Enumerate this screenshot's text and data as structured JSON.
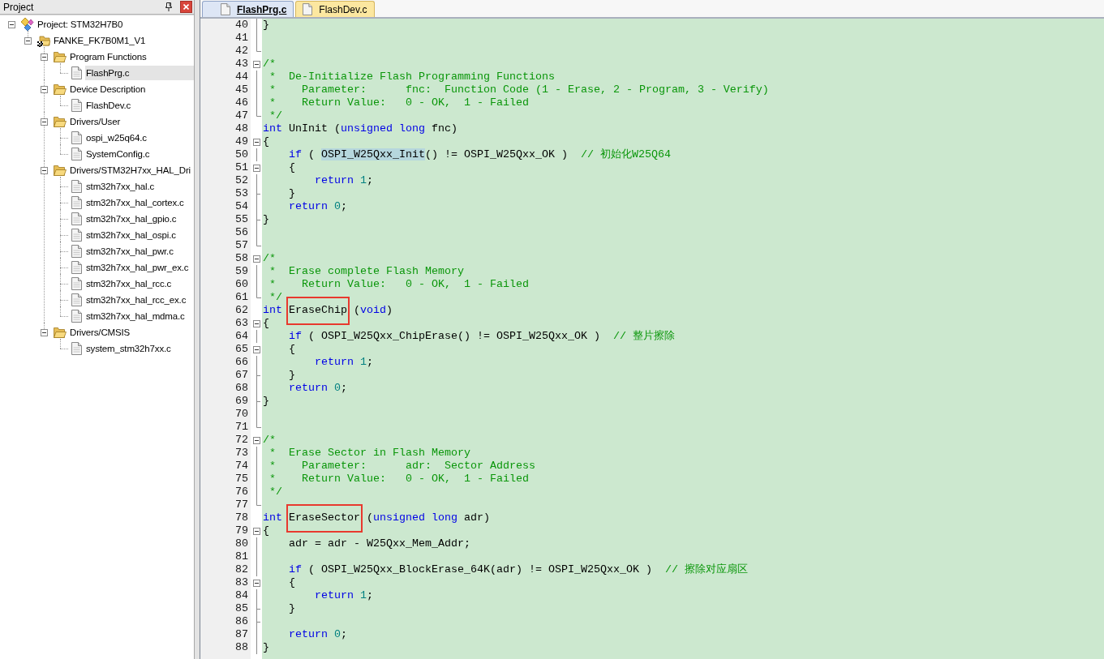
{
  "project_panel": {
    "title": "Project",
    "tree": [
      {
        "label": "Project: STM32H7B0",
        "kind": "project",
        "expanded": true,
        "selected": false,
        "children": [
          {
            "label": "FANKE_FK7B0M1_V1",
            "kind": "target",
            "expanded": true,
            "selected": false,
            "children": [
              {
                "label": "Program Functions",
                "kind": "group",
                "expanded": true,
                "selected": false,
                "children": [
                  {
                    "label": "FlashPrg.c",
                    "kind": "file",
                    "selected": true
                  }
                ]
              },
              {
                "label": "Device Description",
                "kind": "group",
                "expanded": true,
                "selected": false,
                "children": [
                  {
                    "label": "FlashDev.c",
                    "kind": "file",
                    "selected": false
                  }
                ]
              },
              {
                "label": "Drivers/User",
                "kind": "group",
                "expanded": true,
                "selected": false,
                "children": [
                  {
                    "label": "ospi_w25q64.c",
                    "kind": "file",
                    "selected": false
                  },
                  {
                    "label": "SystemConfig.c",
                    "kind": "file",
                    "selected": false
                  }
                ]
              },
              {
                "label": "Drivers/STM32H7xx_HAL_Dri",
                "kind": "group",
                "expanded": true,
                "selected": false,
                "children": [
                  {
                    "label": "stm32h7xx_hal.c",
                    "kind": "file",
                    "selected": false
                  },
                  {
                    "label": "stm32h7xx_hal_cortex.c",
                    "kind": "file",
                    "selected": false
                  },
                  {
                    "label": "stm32h7xx_hal_gpio.c",
                    "kind": "file",
                    "selected": false
                  },
                  {
                    "label": "stm32h7xx_hal_ospi.c",
                    "kind": "file",
                    "selected": false
                  },
                  {
                    "label": "stm32h7xx_hal_pwr.c",
                    "kind": "file",
                    "selected": false
                  },
                  {
                    "label": "stm32h7xx_hal_pwr_ex.c",
                    "kind": "file",
                    "selected": false
                  },
                  {
                    "label": "stm32h7xx_hal_rcc.c",
                    "kind": "file",
                    "selected": false
                  },
                  {
                    "label": "stm32h7xx_hal_rcc_ex.c",
                    "kind": "file",
                    "selected": false
                  },
                  {
                    "label": "stm32h7xx_hal_mdma.c",
                    "kind": "file",
                    "selected": false
                  }
                ]
              },
              {
                "label": "Drivers/CMSIS",
                "kind": "group",
                "expanded": true,
                "selected": false,
                "children": [
                  {
                    "label": "system_stm32h7xx.c",
                    "kind": "file",
                    "selected": false
                  }
                ]
              }
            ]
          }
        ]
      }
    ]
  },
  "editor": {
    "tabs": [
      {
        "label": "FlashPrg.c",
        "selected": true
      },
      {
        "label": "FlashDev.c",
        "selected": false
      }
    ],
    "lines": [
      {
        "number": "40",
        "fold": {
          "kind": "line"
        },
        "tokens": [
          {
            "kind": "plain",
            "text": "}"
          }
        ]
      },
      {
        "number": "41",
        "fold": {
          "kind": "line"
        }
      },
      {
        "number": "42",
        "fold": {
          "kind": "end"
        }
      },
      {
        "number": "43",
        "fold": {
          "kind": "open"
        },
        "tokens": [
          {
            "kind": "comment",
            "text": "/*"
          }
        ]
      },
      {
        "number": "44",
        "fold": {
          "kind": "line"
        },
        "tokens": [
          {
            "kind": "comment",
            "text": " *  De-Initialize Flash Programming Functions"
          }
        ]
      },
      {
        "number": "45",
        "fold": {
          "kind": "line"
        },
        "tokens": [
          {
            "kind": "comment",
            "text": " *    Parameter:      fnc:  Function Code (1 - Erase, 2 - Program, 3 - Verify)"
          }
        ]
      },
      {
        "number": "46",
        "fold": {
          "kind": "line"
        },
        "tokens": [
          {
            "kind": "comment",
            "text": " *    Return Value:   0 - OK,  1 - Failed"
          }
        ]
      },
      {
        "number": "47",
        "fold": {
          "kind": "end"
        },
        "tokens": [
          {
            "kind": "comment",
            "text": " */"
          }
        ]
      },
      {
        "number": "48",
        "tokens": [
          {
            "kind": "keyword",
            "text": "int"
          },
          {
            "kind": "plain",
            "text": " UnInit ("
          },
          {
            "kind": "keyword",
            "text": "unsigned long"
          },
          {
            "kind": "plain",
            "text": " fnc)"
          }
        ]
      },
      {
        "number": "49",
        "fold": {
          "kind": "open"
        },
        "tokens": [
          {
            "kind": "plain",
            "text": "{"
          }
        ]
      },
      {
        "number": "50",
        "fold": {
          "kind": "line"
        },
        "tokens": [
          {
            "kind": "keyword",
            "text": "    if"
          },
          {
            "kind": "plain",
            "text": " ( "
          },
          {
            "kind": "match",
            "text": "OSPI_W25Qxx_Init"
          },
          {
            "kind": "plain",
            "text": "() != OSPI_W25Qxx_OK )  "
          },
          {
            "kind": "comment",
            "text": "// 初始化W25Q64"
          }
        ]
      },
      {
        "number": "51",
        "fold": {
          "kind": "open"
        },
        "tokens": [
          {
            "kind": "plain",
            "text": "    {"
          }
        ]
      },
      {
        "number": "52",
        "fold": {
          "kind": "line"
        },
        "tokens": [
          {
            "kind": "keyword",
            "text": "        return"
          },
          {
            "kind": "number",
            "text": " 1"
          },
          {
            "kind": "plain",
            "text": ";"
          }
        ]
      },
      {
        "number": "53",
        "fold": {
          "kind": "branch"
        },
        "tokens": [
          {
            "kind": "plain",
            "text": "    }"
          }
        ]
      },
      {
        "number": "54",
        "fold": {
          "kind": "line"
        },
        "tokens": [
          {
            "kind": "keyword",
            "text": "    return"
          },
          {
            "kind": "number",
            "text": " 0"
          },
          {
            "kind": "plain",
            "text": ";"
          }
        ]
      },
      {
        "number": "55",
        "fold": {
          "kind": "branch"
        },
        "tokens": [
          {
            "kind": "plain",
            "text": "}"
          }
        ]
      },
      {
        "number": "56",
        "fold": {
          "kind": "line"
        }
      },
      {
        "number": "57",
        "fold": {
          "kind": "end"
        }
      },
      {
        "number": "58",
        "fold": {
          "kind": "open"
        },
        "tokens": [
          {
            "kind": "comment",
            "text": "/*"
          }
        ]
      },
      {
        "number": "59",
        "fold": {
          "kind": "line"
        },
        "tokens": [
          {
            "kind": "comment",
            "text": " *  Erase complete Flash Memory"
          }
        ]
      },
      {
        "number": "60",
        "fold": {
          "kind": "line"
        },
        "tokens": [
          {
            "kind": "comment",
            "text": " *    Return Value:   0 - OK,  1 - Failed"
          }
        ]
      },
      {
        "number": "61",
        "fold": {
          "kind": "end"
        },
        "tokens": [
          {
            "kind": "comment",
            "text": " */"
          }
        ]
      },
      {
        "number": "62",
        "tokens": [
          {
            "kind": "keyword",
            "text": "int "
          },
          {
            "kind": "boxed",
            "text": "EraseChip"
          },
          {
            "kind": "plain",
            "text": " ("
          },
          {
            "kind": "keyword",
            "text": "void"
          },
          {
            "kind": "plain",
            "text": ")"
          }
        ]
      },
      {
        "number": "63",
        "fold": {
          "kind": "open"
        },
        "tokens": [
          {
            "kind": "plain",
            "text": "{"
          }
        ]
      },
      {
        "number": "64",
        "fold": {
          "kind": "line"
        },
        "tokens": [
          {
            "kind": "keyword",
            "text": "    if"
          },
          {
            "kind": "plain",
            "text": " ( OSPI_W25Qxx_ChipErase() != OSPI_W25Qxx_OK )  "
          },
          {
            "kind": "comment",
            "text": "// 整片擦除"
          }
        ]
      },
      {
        "number": "65",
        "fold": {
          "kind": "open"
        },
        "tokens": [
          {
            "kind": "plain",
            "text": "    {"
          }
        ]
      },
      {
        "number": "66",
        "fold": {
          "kind": "line"
        },
        "tokens": [
          {
            "kind": "keyword",
            "text": "        return"
          },
          {
            "kind": "number",
            "text": " 1"
          },
          {
            "kind": "plain",
            "text": ";"
          }
        ]
      },
      {
        "number": "67",
        "fold": {
          "kind": "branch"
        },
        "tokens": [
          {
            "kind": "plain",
            "text": "    }"
          }
        ]
      },
      {
        "number": "68",
        "fold": {
          "kind": "line"
        },
        "tokens": [
          {
            "kind": "keyword",
            "text": "    return"
          },
          {
            "kind": "number",
            "text": " 0"
          },
          {
            "kind": "plain",
            "text": ";"
          }
        ]
      },
      {
        "number": "69",
        "fold": {
          "kind": "branch"
        },
        "tokens": [
          {
            "kind": "plain",
            "text": "}"
          }
        ]
      },
      {
        "number": "70",
        "fold": {
          "kind": "line"
        }
      },
      {
        "number": "71",
        "fold": {
          "kind": "end"
        }
      },
      {
        "number": "72",
        "fold": {
          "kind": "open"
        },
        "tokens": [
          {
            "kind": "comment",
            "text": "/*"
          }
        ]
      },
      {
        "number": "73",
        "fold": {
          "kind": "line"
        },
        "tokens": [
          {
            "kind": "comment",
            "text": " *  Erase Sector in Flash Memory"
          }
        ]
      },
      {
        "number": "74",
        "fold": {
          "kind": "line"
        },
        "tokens": [
          {
            "kind": "comment",
            "text": " *    Parameter:      adr:  Sector Address"
          }
        ]
      },
      {
        "number": "75",
        "fold": {
          "kind": "line"
        },
        "tokens": [
          {
            "kind": "comment",
            "text": " *    Return Value:   0 - OK,  1 - Failed"
          }
        ]
      },
      {
        "number": "76",
        "fold": {
          "kind": "line"
        },
        "tokens": [
          {
            "kind": "comment",
            "text": " */"
          }
        ]
      },
      {
        "number": "77",
        "fold": {
          "kind": "end"
        }
      },
      {
        "number": "78",
        "tokens": [
          {
            "kind": "keyword",
            "text": "int "
          },
          {
            "kind": "boxed",
            "text": "EraseSector"
          },
          {
            "kind": "plain",
            "text": " ("
          },
          {
            "kind": "keyword",
            "text": "unsigned long"
          },
          {
            "kind": "plain",
            "text": " adr)"
          }
        ]
      },
      {
        "number": "79",
        "fold": {
          "kind": "open"
        },
        "tokens": [
          {
            "kind": "plain",
            "text": "{"
          }
        ]
      },
      {
        "number": "80",
        "fold": {
          "kind": "line"
        },
        "tokens": [
          {
            "kind": "plain",
            "text": "    adr = adr - W25Qxx_Mem_Addr;"
          }
        ]
      },
      {
        "number": "81",
        "fold": {
          "kind": "line"
        }
      },
      {
        "number": "82",
        "fold": {
          "kind": "line"
        },
        "tokens": [
          {
            "kind": "keyword",
            "text": "    if"
          },
          {
            "kind": "plain",
            "text": " ( OSPI_W25Qxx_BlockErase_64K(adr) != OSPI_W25Qxx_OK )  "
          },
          {
            "kind": "comment",
            "text": "// 擦除对应扇区"
          }
        ]
      },
      {
        "number": "83",
        "fold": {
          "kind": "open"
        },
        "tokens": [
          {
            "kind": "plain",
            "text": "    {"
          }
        ]
      },
      {
        "number": "84",
        "fold": {
          "kind": "line"
        },
        "tokens": [
          {
            "kind": "keyword",
            "text": "        return"
          },
          {
            "kind": "number",
            "text": " 1"
          },
          {
            "kind": "plain",
            "text": ";"
          }
        ]
      },
      {
        "number": "85",
        "fold": {
          "kind": "branch"
        },
        "tokens": [
          {
            "kind": "plain",
            "text": "    }"
          }
        ]
      },
      {
        "number": "86",
        "fold": {
          "kind": "branch"
        }
      },
      {
        "number": "87",
        "fold": {
          "kind": "line"
        },
        "tokens": [
          {
            "kind": "keyword",
            "text": "    return"
          },
          {
            "kind": "number",
            "text": " 0"
          },
          {
            "kind": "plain",
            "text": ";"
          }
        ]
      },
      {
        "number": "88",
        "fold": {
          "kind": "line"
        },
        "tokens": [
          {
            "kind": "plain",
            "text": "}"
          }
        ]
      }
    ]
  }
}
